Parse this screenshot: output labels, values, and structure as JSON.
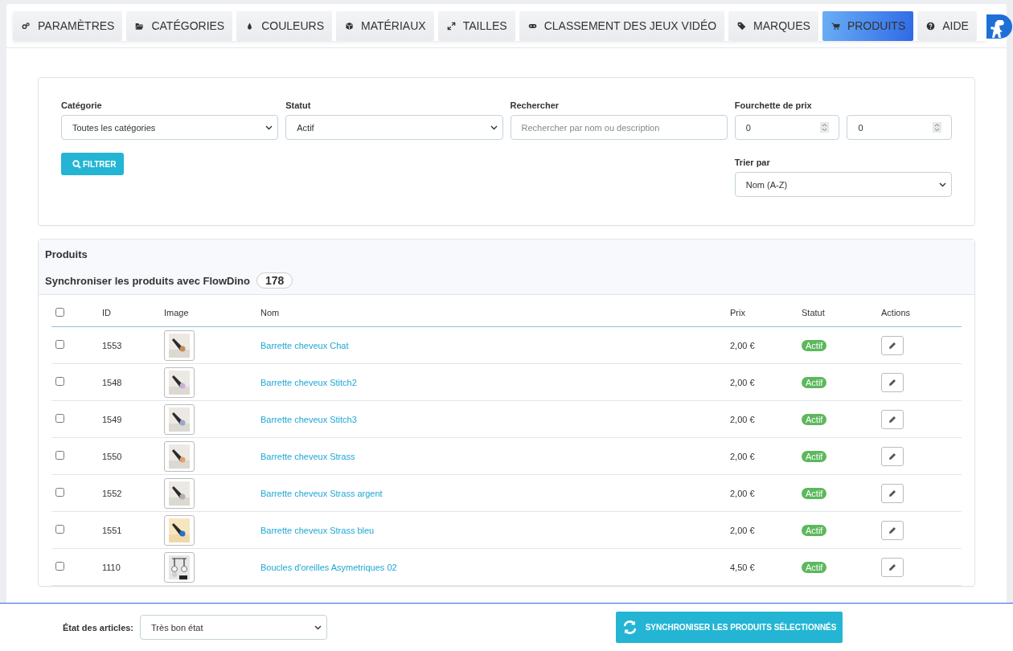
{
  "tabs": [
    {
      "label": "PARAMÈTRES",
      "selected": false
    },
    {
      "label": "CATÉGORIES",
      "selected": false
    },
    {
      "label": "COULEURS",
      "selected": false
    },
    {
      "label": "MATÉRIAUX",
      "selected": false
    },
    {
      "label": "TAILLES",
      "selected": false
    },
    {
      "label": "CLASSEMENT DES JEUX VIDÉO",
      "selected": false
    },
    {
      "label": "MARQUES",
      "selected": false
    },
    {
      "label": "PRODUITS",
      "selected": true
    },
    {
      "label": "AIDE",
      "selected": false
    }
  ],
  "filters": {
    "category": {
      "label": "Catégorie",
      "value": "Toutes les catégories"
    },
    "status": {
      "label": "Statut",
      "value": "Actif"
    },
    "search": {
      "label": "Rechercher",
      "placeholder": "Rechercher par nom ou description"
    },
    "price_range": {
      "label": "Fourchette de prix",
      "min": "0",
      "max": "0"
    },
    "sort": {
      "label": "Trier par",
      "value": "Nom (A-Z)"
    },
    "filter_button": "FILTRER"
  },
  "products": {
    "title": "Produits",
    "sync_label": "Synchroniser les produits avec FlowDino",
    "count": "178",
    "select_all": {
      "checked": false
    },
    "columns": [
      "ID",
      "Image",
      "Nom",
      "Prix",
      "Statut",
      "Actions"
    ],
    "rows": [
      {
        "checked": false,
        "id": "1553",
        "name": "Barrette cheveux Chat",
        "price": "2,00 €",
        "status": "Actif"
      },
      {
        "checked": false,
        "id": "1548",
        "name": "Barrette cheveux Stitch2",
        "price": "2,00 €",
        "status": "Actif"
      },
      {
        "checked": false,
        "id": "1549",
        "name": "Barrette cheveux Stitch3",
        "price": "2,00 €",
        "status": "Actif"
      },
      {
        "checked": false,
        "id": "1550",
        "name": "Barrette cheveux Strass",
        "price": "2,00 €",
        "status": "Actif"
      },
      {
        "checked": false,
        "id": "1552",
        "name": "Barrette cheveux Strass argent",
        "price": "2,00 €",
        "status": "Actif"
      },
      {
        "checked": false,
        "id": "1551",
        "name": "Barrette cheveux Strass bleu",
        "price": "2,00 €",
        "status": "Actif"
      },
      {
        "checked": false,
        "id": "1110",
        "name": "Boucles d'oreilles Asymetriques 02",
        "price": "4,50 €",
        "status": "Actif"
      }
    ]
  },
  "footer": {
    "condition_label": "État des articles:",
    "condition_value": "Très bon état",
    "sync_button": "SYNCHRONISER LES PRODUITS SÉLECTIONNÉS"
  }
}
